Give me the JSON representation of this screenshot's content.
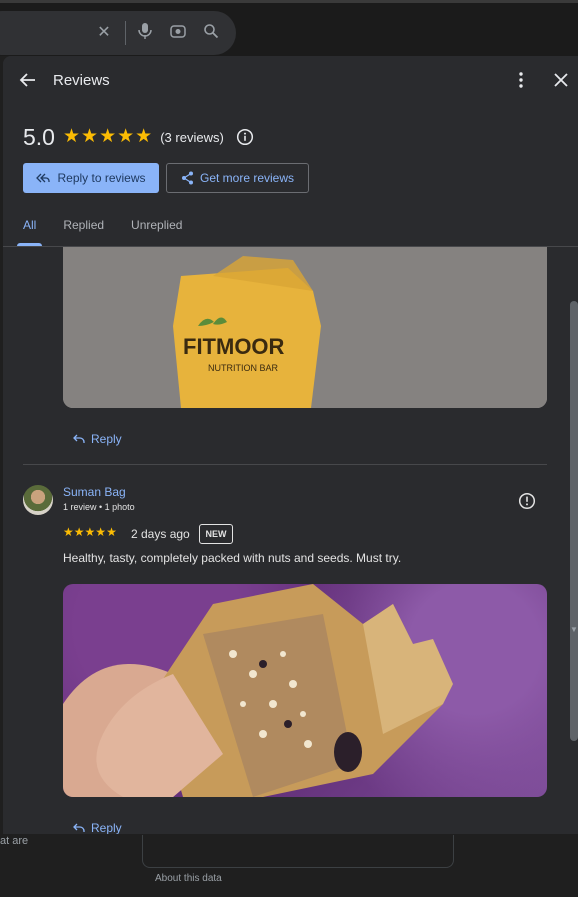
{
  "panel": {
    "title": "Reviews",
    "rating_value": "5.0",
    "star_count": 5,
    "review_count_text": "(3 reviews)",
    "reply_button": "Reply to reviews",
    "get_more_button": "Get more reviews",
    "tabs": [
      "All",
      "Replied",
      "Unreplied"
    ],
    "active_tab": "All"
  },
  "reviews": {
    "first_reply_label": "Reply",
    "second": {
      "name": "Suman Bag",
      "meta": "1 review • 1 photo",
      "stars": 5,
      "date": "2 days ago",
      "badge": "NEW",
      "text": "Healthy, tasty, completely packed with nuts and seeds. Must try.",
      "reply_label": "Reply"
    }
  },
  "product_image": {
    "brand": "FITMOOR",
    "subtitle": "NUTRITION BAR"
  },
  "background": {
    "left_text": "at are",
    "about_text": "About this data"
  },
  "colors": {
    "accent": "#8ab4f8",
    "star": "#fbbc04",
    "panel_bg": "#2a2b2e"
  },
  "icons": [
    "arrow-left-icon",
    "more-vert-icon",
    "close-icon",
    "info-icon",
    "reply-all-icon",
    "share-icon",
    "reply-icon",
    "flag-icon",
    "mic-icon",
    "lens-icon",
    "search-icon"
  ]
}
